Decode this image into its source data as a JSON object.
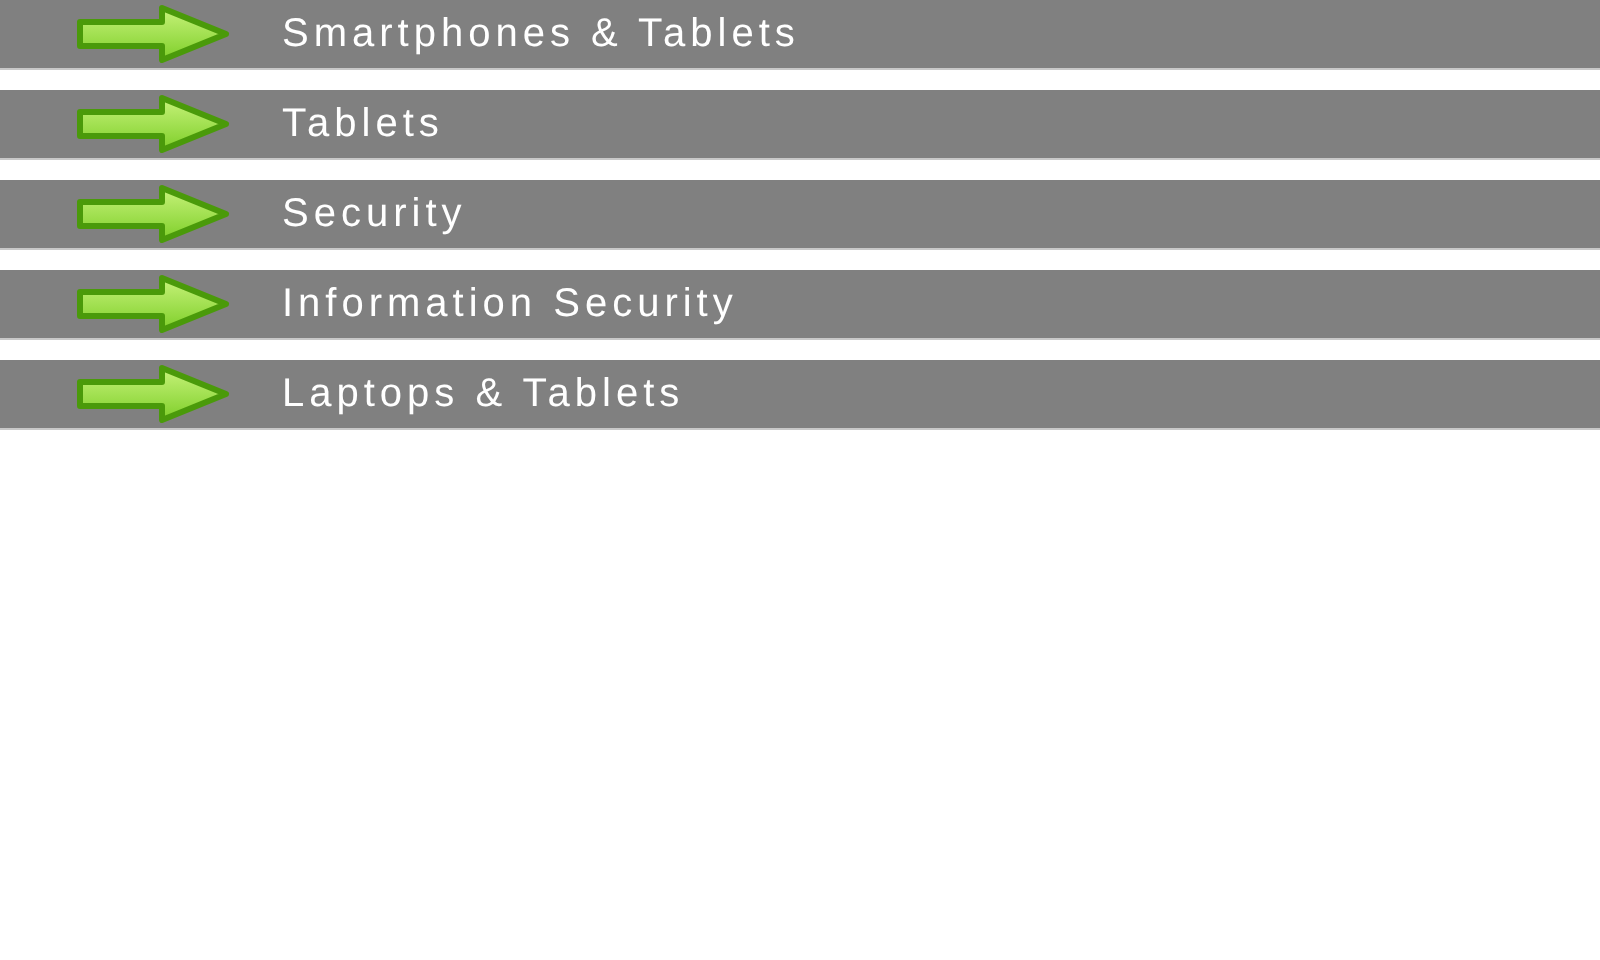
{
  "items": [
    {
      "label": "Smartphones & Tablets"
    },
    {
      "label": "Tablets"
    },
    {
      "label": "Security"
    },
    {
      "label": "Information Security"
    },
    {
      "label": "Laptops & Tablets"
    }
  ]
}
